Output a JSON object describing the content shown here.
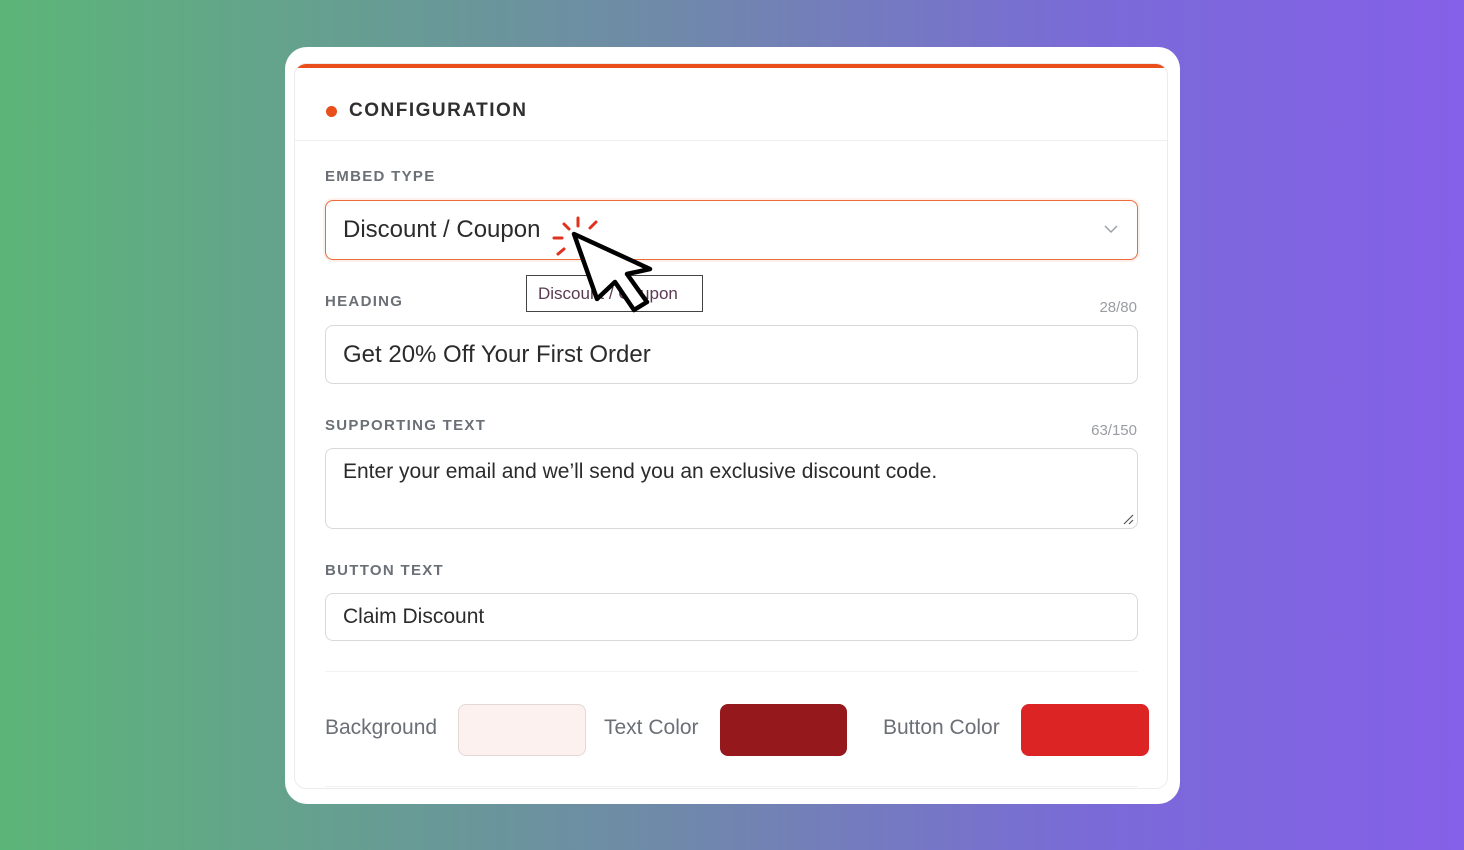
{
  "card": {
    "title": "CONFIGURATION",
    "accent_color": "#ea4e1b"
  },
  "embed_type": {
    "label": "EMBED TYPE",
    "value": "Discount / Coupon",
    "icon": "chevron-down-icon"
  },
  "tooltip": {
    "text": "Discount / Coupon"
  },
  "heading": {
    "label": "HEADING",
    "counter": "28/80",
    "value": "Get 20% Off Your First Order"
  },
  "supporting_text": {
    "label": "SUPPORTING TEXT",
    "counter": "63/150",
    "value": "Enter your email and we’ll send you an exclusive discount code."
  },
  "button_text": {
    "label": "BUTTON TEXT",
    "value": "Claim Discount"
  },
  "colors": {
    "background": {
      "label": "Background",
      "color": "#fdf1ef"
    },
    "text_color": {
      "label": "Text Color",
      "color": "#95191c"
    },
    "button_color": {
      "label": "Button Color",
      "color": "#dd2424"
    }
  }
}
